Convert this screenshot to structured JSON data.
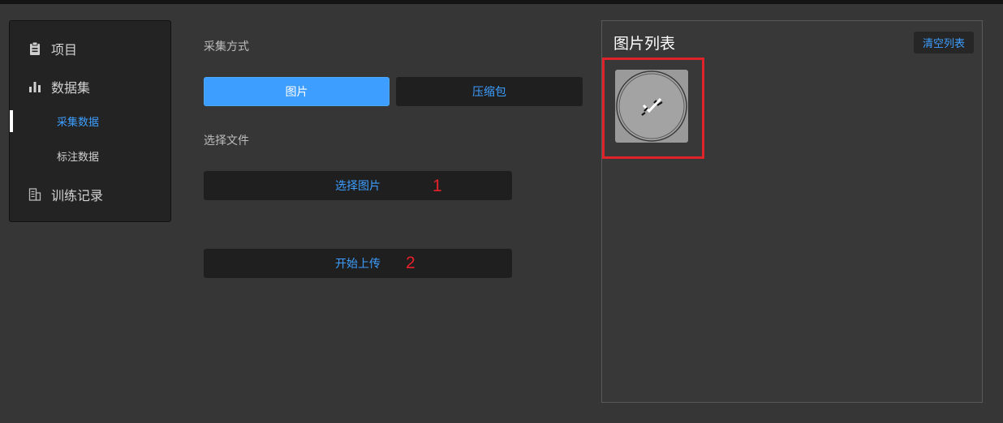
{
  "sidebar": {
    "items": [
      {
        "label": "项目",
        "icon": "clipboard-icon"
      },
      {
        "label": "数据集",
        "icon": "bar-chart-icon"
      },
      {
        "label": "采集数据",
        "active": true
      },
      {
        "label": "标注数据"
      },
      {
        "label": "训练记录",
        "icon": "building-icon"
      }
    ]
  },
  "main": {
    "collect_mode_label": "采集方式",
    "mode_image": "图片",
    "mode_zip": "压缩包",
    "select_file_label": "选择文件",
    "select_image_button": "选择图片",
    "upload_button": "开始上传",
    "annotations": [
      "1",
      "2"
    ]
  },
  "image_list": {
    "title": "图片列表",
    "clear_button": "清空列表",
    "items": [
      {
        "thumbnail": "circle-with-checkmark",
        "selected": true
      }
    ]
  },
  "colors": {
    "accent": "#3d9eff",
    "background": "#363636",
    "highlight": "#e0232b"
  }
}
